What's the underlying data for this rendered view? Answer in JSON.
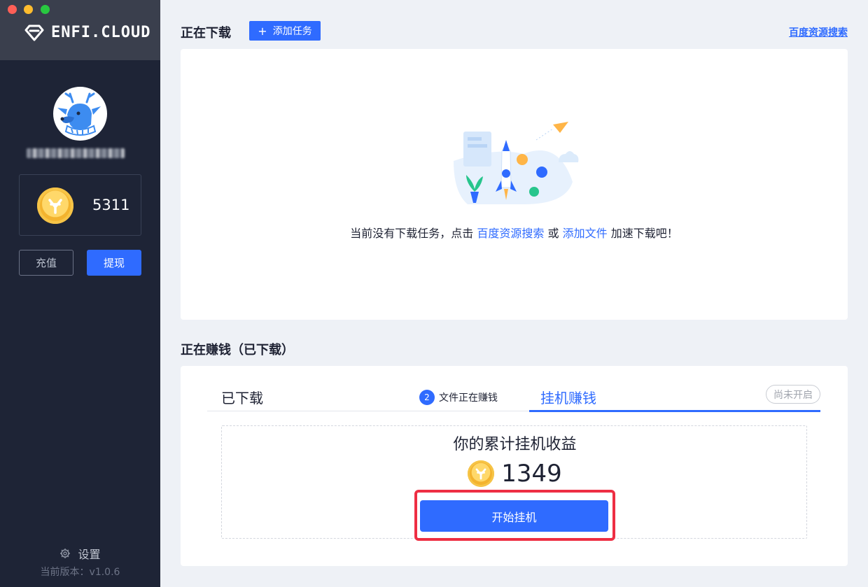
{
  "app": {
    "logo_text": "ENFI.CLOUD"
  },
  "sidebar": {
    "balance": "5311",
    "recharge_label": "充值",
    "withdraw_label": "提现",
    "settings_label": "设置",
    "version": "当前版本：v1.0.6"
  },
  "downloading": {
    "title": "正在下载",
    "add_task_label": "添加任务",
    "search_link": "百度资源搜索",
    "empty_prefix": "当前没有下载任务，点击 ",
    "empty_link1": "百度资源搜索",
    "empty_or": " 或 ",
    "empty_link2": "添加文件",
    "empty_suffix": " 加速下载吧！"
  },
  "earning": {
    "title": "正在赚钱（已下载）",
    "tab_downloaded": "已下载",
    "files_count": "2",
    "files_label": "文件正在赚钱",
    "tab_hang": "挂机赚钱",
    "status": "尚未开启",
    "total_title": "你的累计挂机收益",
    "total_value": "1349",
    "start_label": "开始挂机"
  },
  "colors": {
    "accent": "#2f6bff",
    "sidebar_bg": "#1e2436",
    "highlight": "#ee2e43",
    "coin": "#f3b32e"
  }
}
